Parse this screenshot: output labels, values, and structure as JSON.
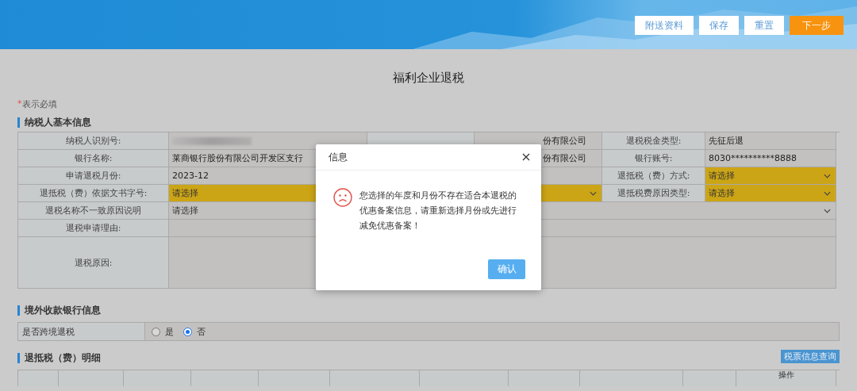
{
  "header": {
    "buttons": [
      {
        "label": "附送资料",
        "kind": "plain"
      },
      {
        "label": "保存",
        "kind": "plain"
      },
      {
        "label": "重置",
        "kind": "plain"
      },
      {
        "label": "下一步",
        "kind": "primary"
      }
    ]
  },
  "page_title": "福利企业退税",
  "required_note": {
    "mark": "*",
    "text": "表示必填"
  },
  "taxpayer_section": {
    "title": "纳税人基本信息",
    "rows": [
      [
        {
          "kind": "label",
          "text": "纳税人识别号:"
        },
        {
          "kind": "masked"
        },
        {
          "kind": "blank"
        },
        {
          "kind": "value",
          "text": "份有限公司"
        },
        {
          "kind": "label",
          "text": "退税税金类型:"
        },
        {
          "kind": "value",
          "text": "先征后退"
        }
      ],
      [
        {
          "kind": "label",
          "text": "银行名称:"
        },
        {
          "kind": "value",
          "text": "莱商银行股份有限公司开发区支行"
        },
        {
          "kind": "blank"
        },
        {
          "kind": "value",
          "text": "份有限公司"
        },
        {
          "kind": "label",
          "text": "银行账号:"
        },
        {
          "kind": "value",
          "text": "8030**********8888"
        }
      ],
      [
        {
          "kind": "label",
          "text": "申请退税月份:"
        },
        {
          "kind": "value",
          "text": "2023-12"
        },
        {
          "kind": "value"
        },
        {
          "kind": "merged"
        },
        {
          "kind": "label",
          "text": "退抵税（费）方式:"
        },
        {
          "kind": "select",
          "text": "请选择",
          "highlighted": true
        }
      ],
      [
        {
          "kind": "label",
          "text": "退抵税（费）依据文书字号:"
        },
        {
          "kind": "select",
          "text": "请选择",
          "highlighted": true
        },
        {
          "kind": "merged"
        },
        {
          "kind": "merged"
        },
        {
          "kind": "label",
          "text": "退抵税费原因类型:"
        },
        {
          "kind": "select",
          "text": "请选择",
          "highlighted": true
        }
      ],
      [
        {
          "kind": "label",
          "text": "退税名称不一致原因说明"
        },
        {
          "kind": "select",
          "text": "请选择",
          "highlighted": false
        },
        {
          "kind": "merged"
        },
        {
          "kind": "merged"
        },
        {
          "kind": "merged"
        },
        {
          "kind": "merged"
        }
      ],
      [
        {
          "kind": "label",
          "text": "退税申请理由:"
        },
        {
          "kind": "value"
        },
        {
          "kind": "merged"
        },
        {
          "kind": "merged"
        },
        {
          "kind": "merged"
        },
        {
          "kind": "merged"
        }
      ],
      [
        {
          "kind": "label",
          "text": "退税原因:"
        },
        {
          "kind": "textarea"
        },
        {
          "kind": "merged"
        },
        {
          "kind": "merged"
        },
        {
          "kind": "merged"
        },
        {
          "kind": "merged"
        }
      ]
    ]
  },
  "foreign_bank_section": {
    "title": "境外收款银行信息",
    "label": "是否跨境退税",
    "options": [
      {
        "label": "是",
        "selected": false
      },
      {
        "label": "否",
        "selected": true
      }
    ]
  },
  "detail_section": {
    "title": "退抵税（费）明细",
    "query_button": "税票信息查询",
    "columns": [
      {},
      {},
      {},
      {},
      {},
      {},
      {},
      {},
      {},
      {},
      {
        "label": "操作"
      }
    ]
  },
  "dialog": {
    "title": "信息",
    "message": "您选择的年度和月份不存在适合本退税的优惠备案信息，请重新选择月份或先进行减免优惠备案！",
    "confirm": "确认"
  }
}
